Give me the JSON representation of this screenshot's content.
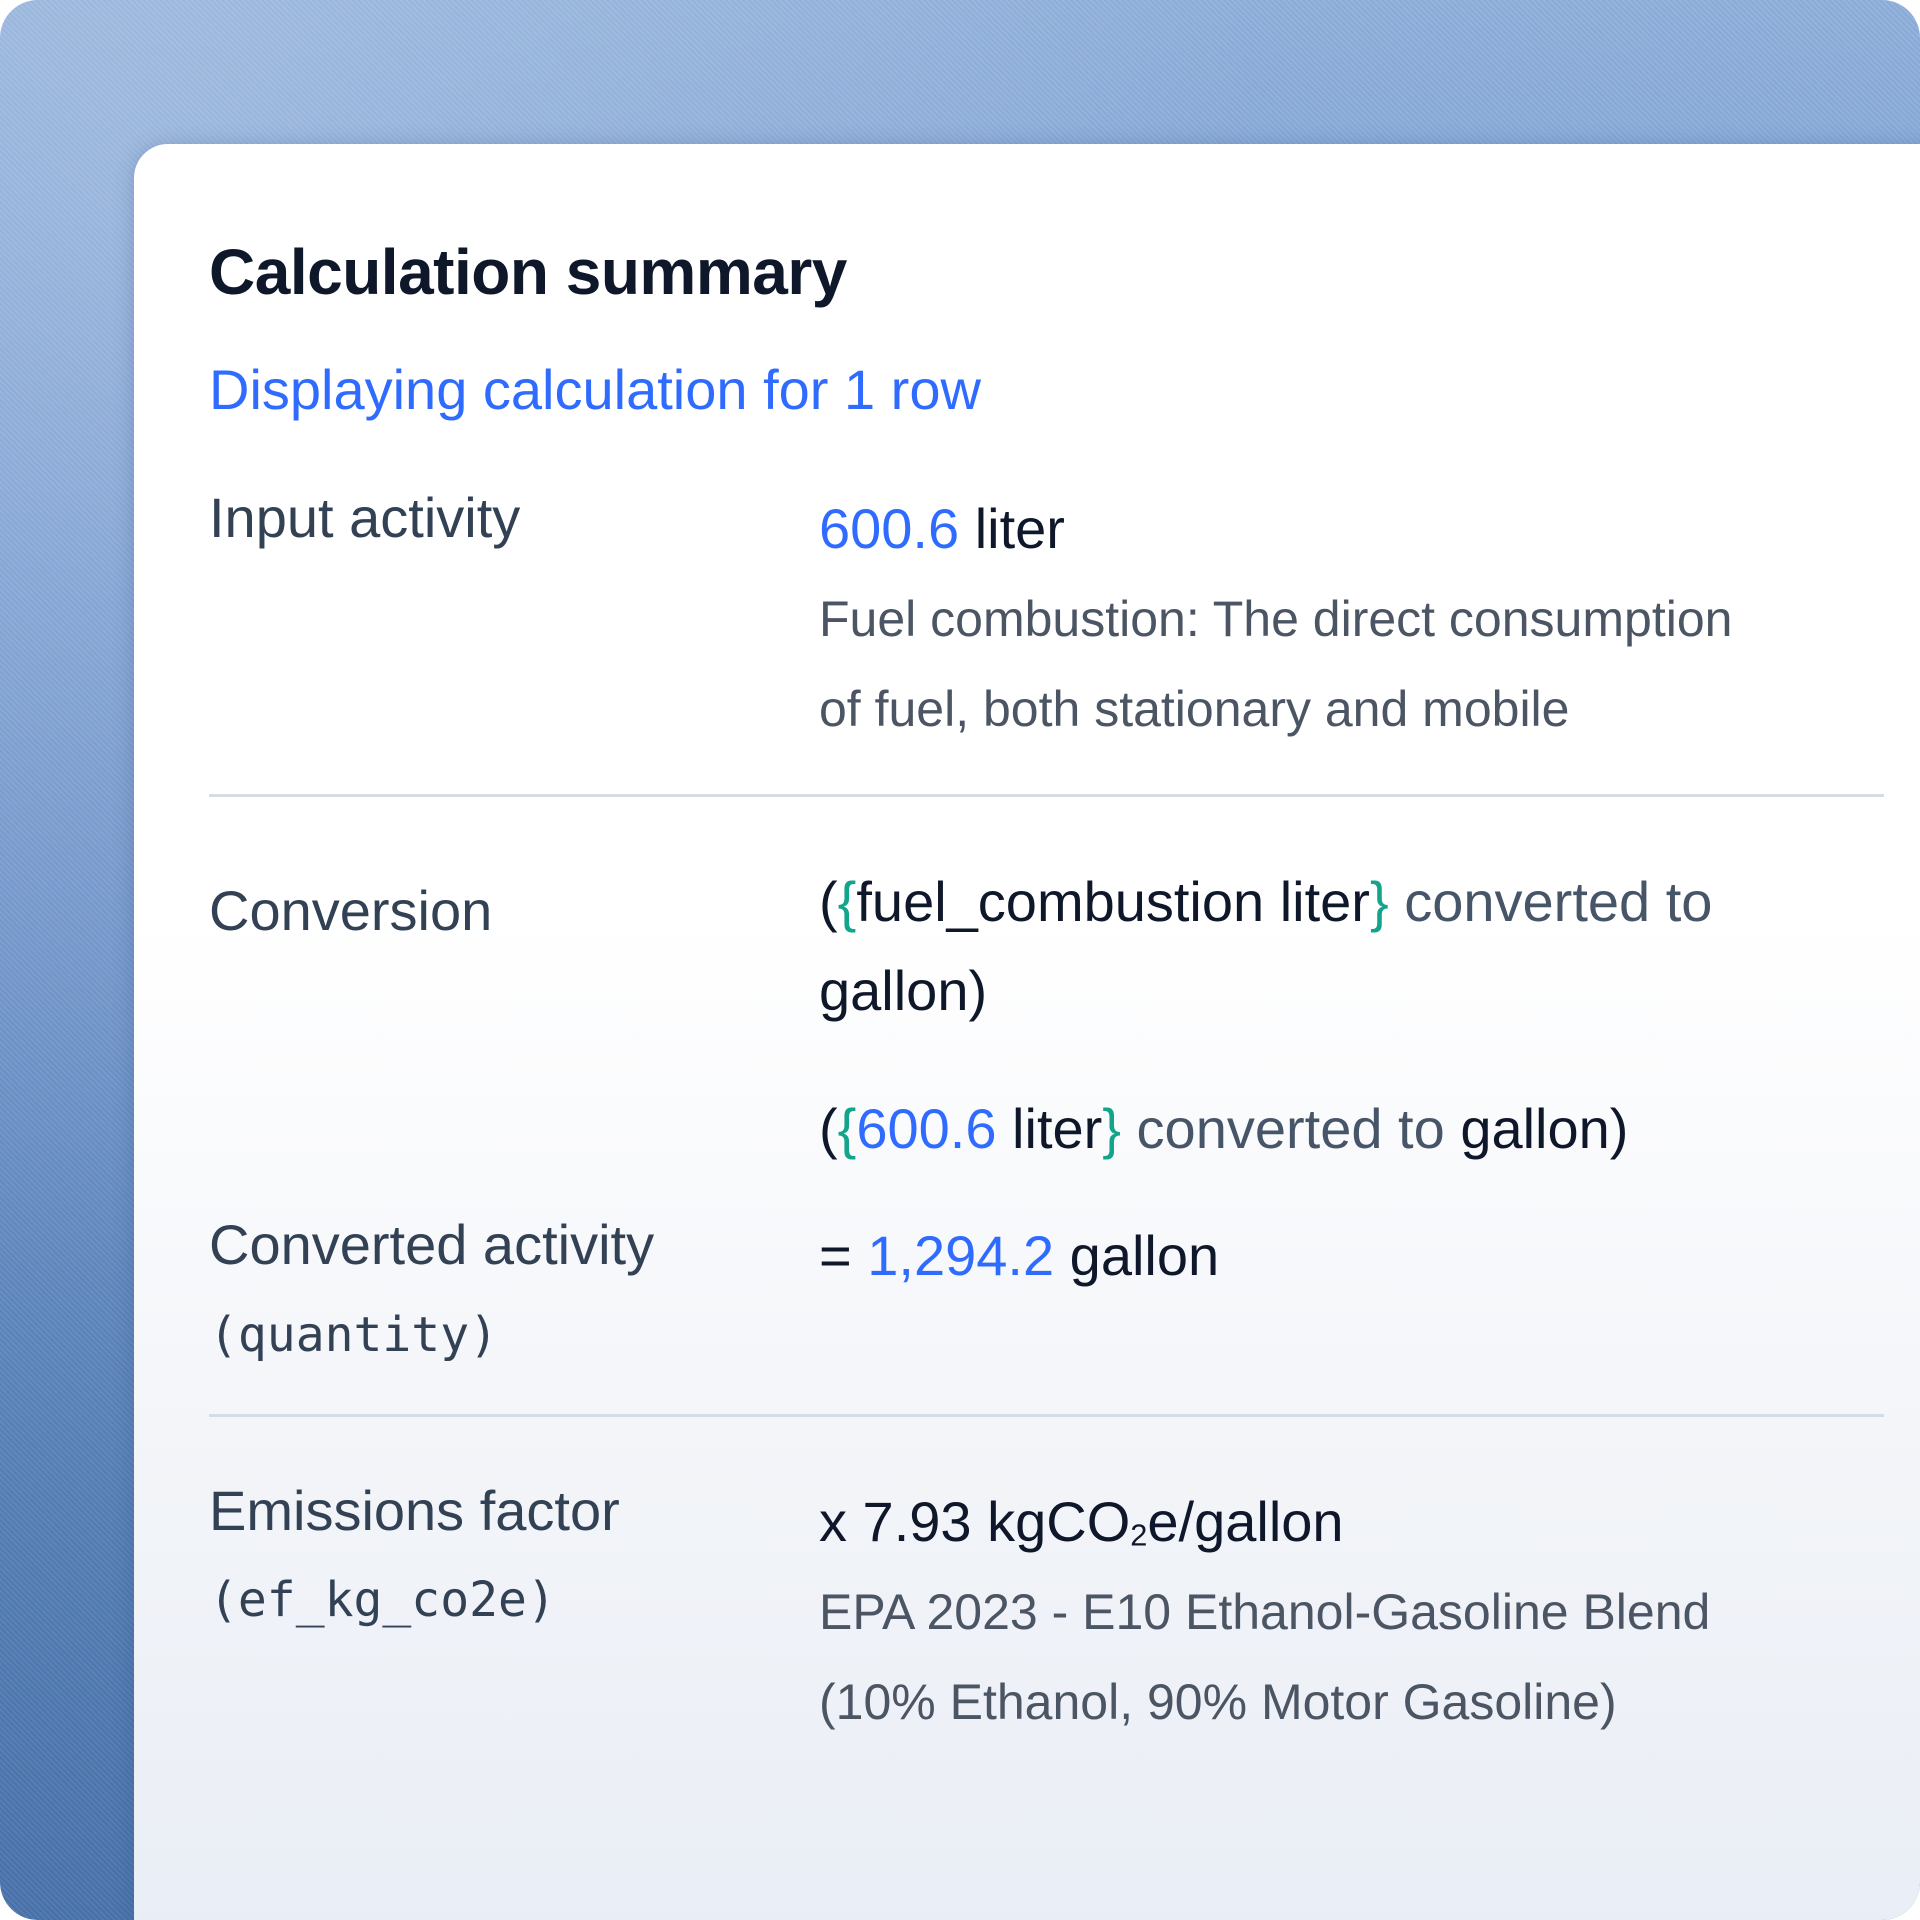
{
  "card": {
    "title": "Calculation summary",
    "subtitle": "Displaying calculation for 1 row"
  },
  "input_activity": {
    "label": "Input activity",
    "amount": "600.6",
    "unit": "liter",
    "description_line1": "Fuel combustion: The direct consumption",
    "description_line2": "of fuel, both stationary and mobile"
  },
  "conversion": {
    "label": "Conversion",
    "formula_open": "(",
    "brace_open": "{",
    "formula_variable": "fuel_combustion liter",
    "brace_close": "}",
    "formula_converted_to": " converted to",
    "formula_target": "gallon",
    "formula_close": ")",
    "evaluated_amount": "600.6",
    "evaluated_unit": " liter",
    "evaluated_converted_to": " converted to ",
    "evaluated_target": "gallon"
  },
  "converted_activity": {
    "label": "Converted activity",
    "code": "(quantity)",
    "prefix": "= ",
    "amount": "1,294.2",
    "unit": " gallon"
  },
  "emissions_factor": {
    "label": "Emissions factor",
    "code": "(ef_kg_co2e)",
    "prefix": "x 7.93 kgCO",
    "sub": "2",
    "suffix": "e/gallon",
    "source_line1": "EPA 2023 - E10 Ethanol-Gasoline Blend",
    "source_line2": "(10% Ethanol, 90% Motor Gasoline)"
  }
}
